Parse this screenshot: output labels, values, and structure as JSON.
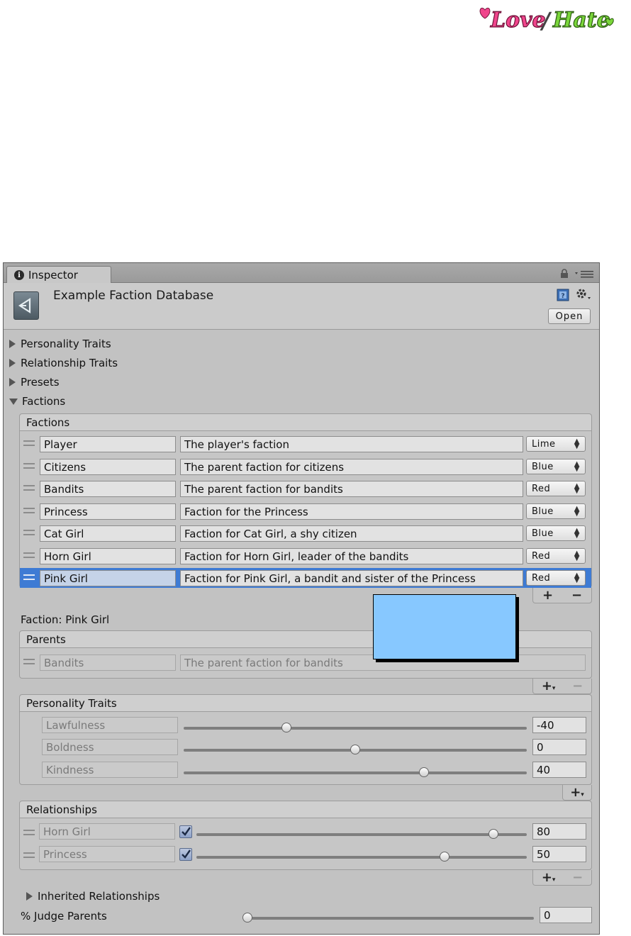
{
  "logo": {
    "text_love": "Love",
    "text_hate": "Hate"
  },
  "window": {
    "tab_label": "Inspector",
    "asset_title": "Example Faction Database",
    "open_button": "Open"
  },
  "foldouts": {
    "personality_traits": "Personality Traits",
    "relationship_traits": "Relationship Traits",
    "presets": "Presets",
    "factions": "Factions"
  },
  "factions_list": {
    "header": "Factions",
    "rows": [
      {
        "name": "Player",
        "description": "The player's faction",
        "color": "Lime"
      },
      {
        "name": "Citizens",
        "description": "The parent faction for citizens",
        "color": "Blue"
      },
      {
        "name": "Bandits",
        "description": "The parent faction for bandits",
        "color": "Red"
      },
      {
        "name": "Princess",
        "description": "Faction for the Princess",
        "color": "Blue"
      },
      {
        "name": "Cat Girl",
        "description": "Faction for Cat Girl, a shy citizen",
        "color": "Blue"
      },
      {
        "name": "Horn Girl",
        "description": "Faction for Horn Girl, leader of the bandits",
        "color": "Red"
      },
      {
        "name": "Pink Girl",
        "description": "Faction for Pink Girl, a bandit and sister of the Princess",
        "color": "Red"
      }
    ],
    "selected_index": 6
  },
  "faction_detail": {
    "label": "Faction: Pink Girl",
    "parents": {
      "header": "Parents",
      "rows": [
        {
          "name": "Bandits",
          "description": "The parent faction for bandits"
        }
      ]
    },
    "personality_traits": {
      "header": "Personality Traits",
      "rows": [
        {
          "name": "Lawfulness",
          "value": "-40",
          "level": 0.3
        },
        {
          "name": "Boldness",
          "value": "0",
          "level": 0.5
        },
        {
          "name": "Kindness",
          "value": "40",
          "level": 0.7
        }
      ]
    },
    "relationships": {
      "header": "Relationships",
      "rows": [
        {
          "name": "Horn Girl",
          "value": "80",
          "level": 0.9,
          "checked": true
        },
        {
          "name": "Princess",
          "value": "50",
          "level": 0.75,
          "checked": true
        }
      ]
    },
    "inherited_relationships": "Inherited Relationships",
    "judge_parents": {
      "label": "% Judge Parents",
      "value": "0",
      "level": 0.0
    }
  },
  "colors": {
    "selection": "#3e7bd4",
    "tooltip": "#87c8ff",
    "logo_pink": "#f0458c",
    "logo_green": "#7ad63a"
  }
}
